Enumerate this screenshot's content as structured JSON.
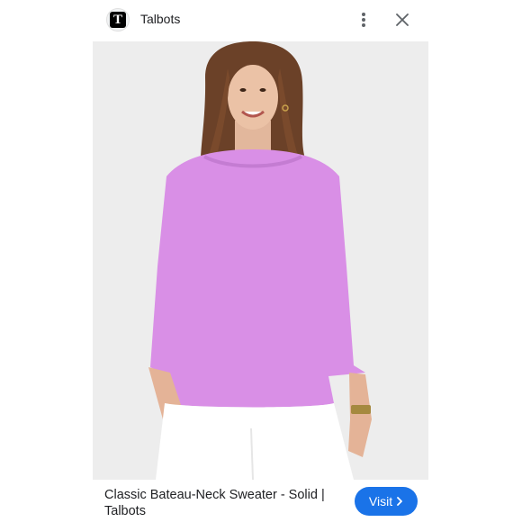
{
  "header": {
    "site_name": "Talbots",
    "logo_letter": "T",
    "more_icon": "more-vert-icon",
    "close_icon": "close-icon"
  },
  "product": {
    "title": "Classic Bateau-Neck Sweater - Solid | Talbots",
    "image_alt": "Woman wearing a lilac bateau-neck three-quarter sleeve sweater and white pants",
    "sweater_color": "#d98fe6"
  },
  "actions": {
    "visit_label": "Visit",
    "visit_icon": "chevron-right-icon"
  },
  "colors": {
    "accent": "#1a73e8",
    "text": "#202124",
    "image_background": "#eeeeee"
  }
}
